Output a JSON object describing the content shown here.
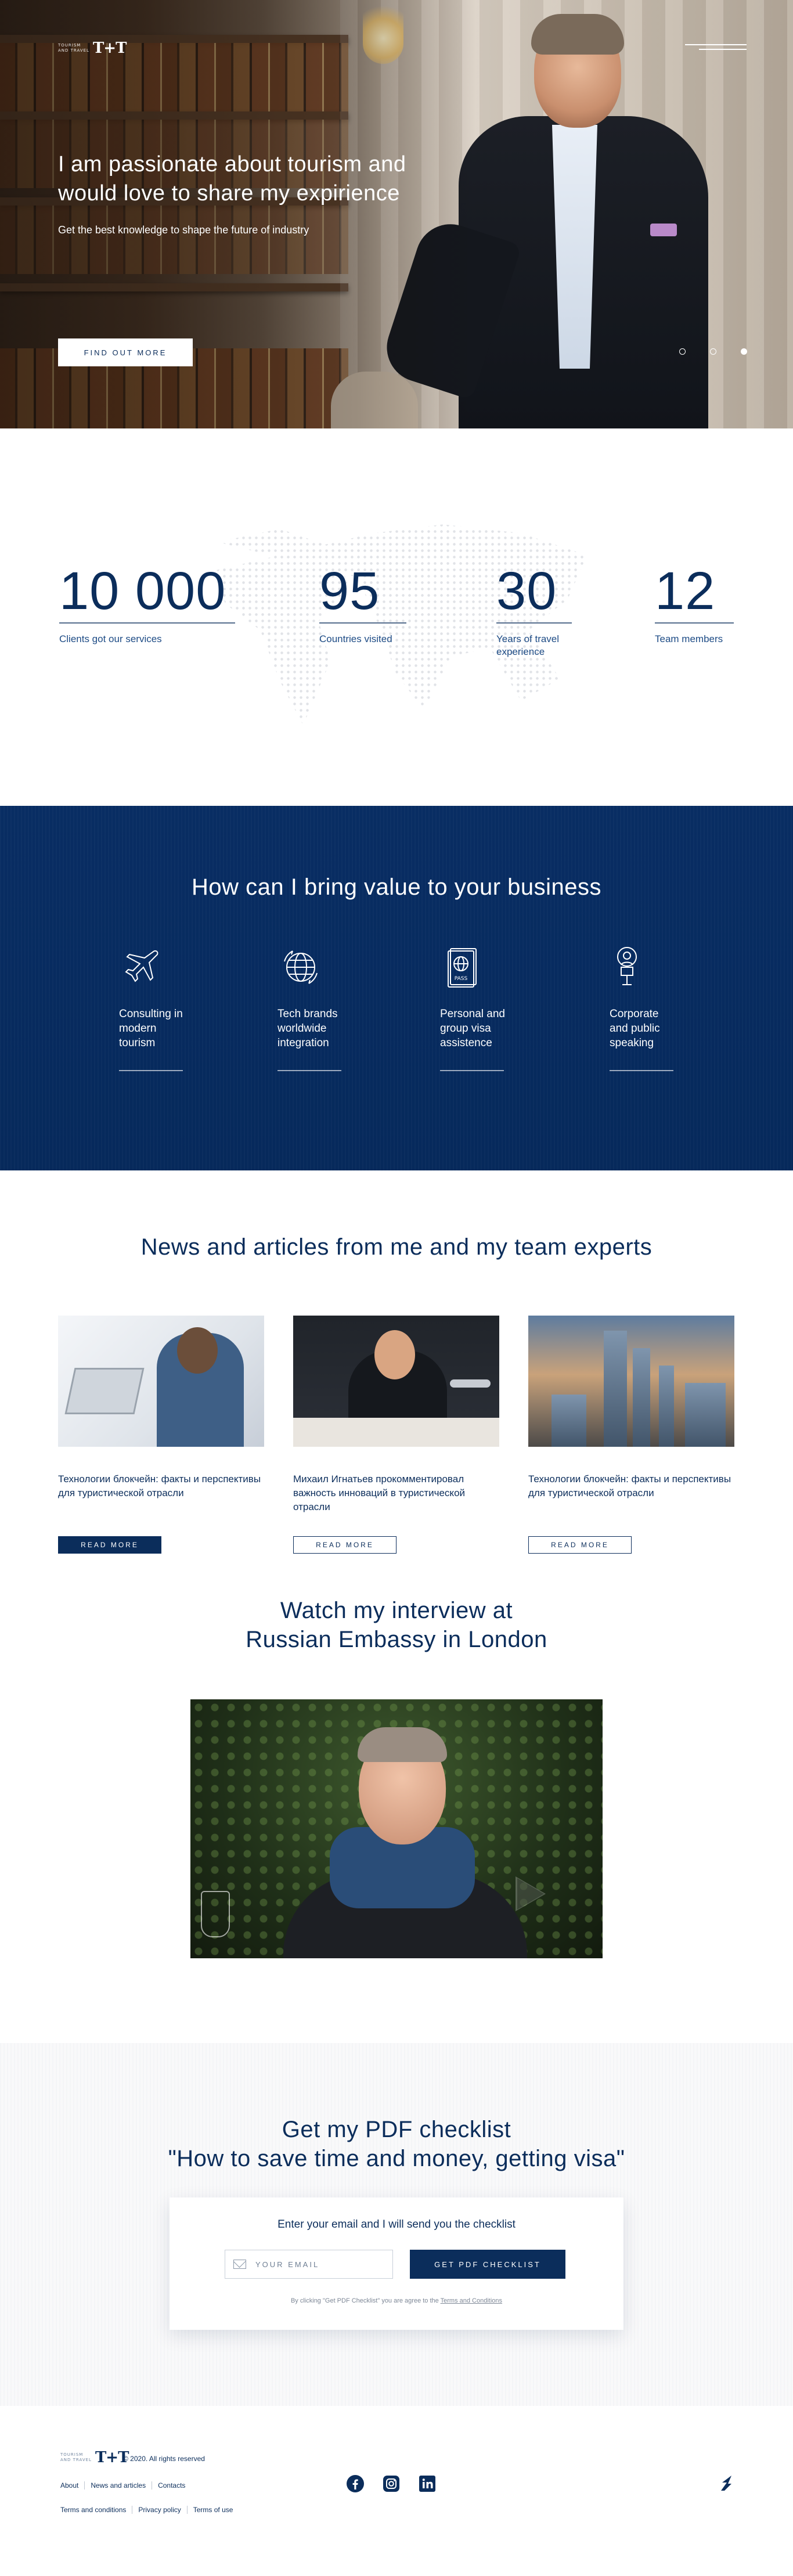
{
  "hero": {
    "logo_small_line1": "TOURISM",
    "logo_small_line2": "AND TRAVEL",
    "logo_mark": "T+T",
    "headline": "I am passionate about tourism and would love to share my expirience",
    "subline": "Get the best knowledge to shape the future of industry",
    "cta_label": "FIND OUT MORE",
    "slides_total": 3,
    "active_slide": 3
  },
  "stats": [
    {
      "value": "10 000",
      "label": "Clients got our services"
    },
    {
      "value": "95",
      "label": "Countries visited"
    },
    {
      "value": "30",
      "label": "Years of travel experience"
    },
    {
      "value": "12",
      "label": "Team members"
    }
  ],
  "services": {
    "title": "How can I bring value to your business",
    "items": [
      {
        "icon": "airplane-icon",
        "label": "Consulting in modern tourism"
      },
      {
        "icon": "globe-icon",
        "label": "Tech brands worldwide integration"
      },
      {
        "icon": "passport-icon",
        "label": "Personal and group visa assistence"
      },
      {
        "icon": "speaker-icon",
        "label": "Corporate and public speaking"
      }
    ]
  },
  "news": {
    "title": "News and articles from me and my team experts",
    "cards": [
      {
        "title": "Технологии блокчейн: факты и перспективы для туристической отрасли",
        "button": "READ MORE"
      },
      {
        "title": "Михаил Игнатьев прокомментировал важность инноваций в туристической отрасли",
        "button": "READ MORE"
      },
      {
        "title": "Технологии блокчейн: факты и перспективы для туристической отрасли",
        "button": "READ MORE"
      }
    ]
  },
  "interview": {
    "title_line1": "Watch my interview at",
    "title_line2": "Russian Embassy in London"
  },
  "checklist": {
    "title_line1": "Get my PDF checklist",
    "title_line2": "\"How to save time and money, getting visa\"",
    "prompt": "Enter your email and I will send you the checklist",
    "email_placeholder": "YOUR EMAIL",
    "button": "GET PDF CHECKLIST",
    "legal_prefix": "By clicking \"Get PDF Checklist\" you are agree to the",
    "legal_link": "Terms and Conditions"
  },
  "footer": {
    "copyright": "©  2020. All rights reserved",
    "nav_links": [
      "About",
      "News and articles",
      "Contacts"
    ],
    "legal_links": [
      "Terms and conditions",
      "Privacy policy",
      "Terms of use"
    ],
    "social": [
      "facebook-icon",
      "instagram-icon",
      "linkedin-icon"
    ]
  },
  "colors": {
    "navy": "#0b2d5b",
    "navy_section": "#082d63",
    "white": "#ffffff"
  }
}
